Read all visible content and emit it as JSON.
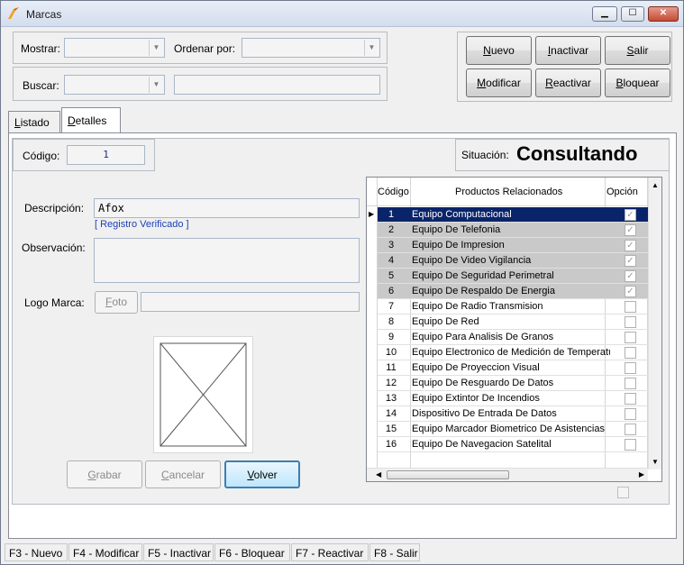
{
  "window": {
    "title": "Marcas",
    "min": "▁",
    "max": "☐",
    "close": "✕"
  },
  "filters": {
    "mostrar_label": "Mostrar:",
    "ordenar_label": "Ordenar por:",
    "buscar_label": "Buscar:"
  },
  "actions": {
    "nuevo": {
      "u": "N",
      "rest": "uevo"
    },
    "inactivar": {
      "u": "I",
      "rest": "nactivar"
    },
    "salir": {
      "u": "S",
      "rest": "alir"
    },
    "modificar": {
      "u": "M",
      "rest": "odificar"
    },
    "reactivar": {
      "u": "R",
      "rest": "eactivar"
    },
    "bloquear": {
      "u": "B",
      "rest": "loquear"
    }
  },
  "tabs": {
    "listado": {
      "u": "L",
      "rest": "istado"
    },
    "detalles": {
      "u": "D",
      "rest": "etalles"
    }
  },
  "detail": {
    "codigo_label": "Código:",
    "codigo_value": "1",
    "situacion_label": "Situación:",
    "situacion_value": "Consultando",
    "descripcion_label": "Descripción:",
    "descripcion_value": "Afox",
    "verificado": "[ Registro Verificado ]",
    "observacion_label": "Observación:",
    "logo_label": "Logo Marca:",
    "foto": {
      "u": "F",
      "rest": "oto"
    }
  },
  "grid": {
    "headers": {
      "codigo": "Código",
      "productos": "Productos Relacionados",
      "opcion": "Opción"
    },
    "rows": [
      {
        "code": "1",
        "name": "Equipo Computacional",
        "checked": true
      },
      {
        "code": "2",
        "name": "Equipo De Telefonia",
        "checked": true
      },
      {
        "code": "3",
        "name": "Equipo De Impresion",
        "checked": true
      },
      {
        "code": "4",
        "name": "Equipo De Video Vigilancia",
        "checked": true
      },
      {
        "code": "5",
        "name": "Equipo De Seguridad Perimetral",
        "checked": true
      },
      {
        "code": "6",
        "name": "Equipo De Respaldo De Energia",
        "checked": true
      },
      {
        "code": "7",
        "name": "Equipo De Radio Transmision",
        "checked": false
      },
      {
        "code": "8",
        "name": "Equipo De Red",
        "checked": false
      },
      {
        "code": "9",
        "name": "Equipo Para Analisis De Granos",
        "checked": false
      },
      {
        "code": "10",
        "name": "Equipo Electronico de Medición de Temperatu",
        "checked": false
      },
      {
        "code": "11",
        "name": "Equipo De Proyeccion Visual",
        "checked": false
      },
      {
        "code": "12",
        "name": "Equipo De Resguardo De Datos",
        "checked": false
      },
      {
        "code": "13",
        "name": "Equipo Extintor De Incendios",
        "checked": false
      },
      {
        "code": "14",
        "name": "Dispositivo De Entrada De Datos",
        "checked": false
      },
      {
        "code": "15",
        "name": "Equipo Marcador Biometrico De Asistencias",
        "checked": false
      },
      {
        "code": "16",
        "name": "Equipo De Navegacion Satelital",
        "checked": false
      }
    ]
  },
  "bottom_buttons": {
    "grabar": {
      "u": "G",
      "rest": "rabar"
    },
    "cancelar": {
      "u": "C",
      "rest": "ancelar"
    },
    "volver": {
      "u": "V",
      "rest": "olver"
    }
  },
  "statusbar": [
    "F3 - Nuevo",
    "F4 - Modificar",
    "F5 - Inactivar",
    "F6 - Bloquear",
    "F7 - Reactivar",
    "F8 - Salir"
  ],
  "icons": {
    "check": "✓",
    "row_pointer": "▶",
    "scroll_up": "▲",
    "scroll_down": "▼",
    "scroll_left": "◀",
    "scroll_right": "▶",
    "combo_arrow": "▼"
  }
}
